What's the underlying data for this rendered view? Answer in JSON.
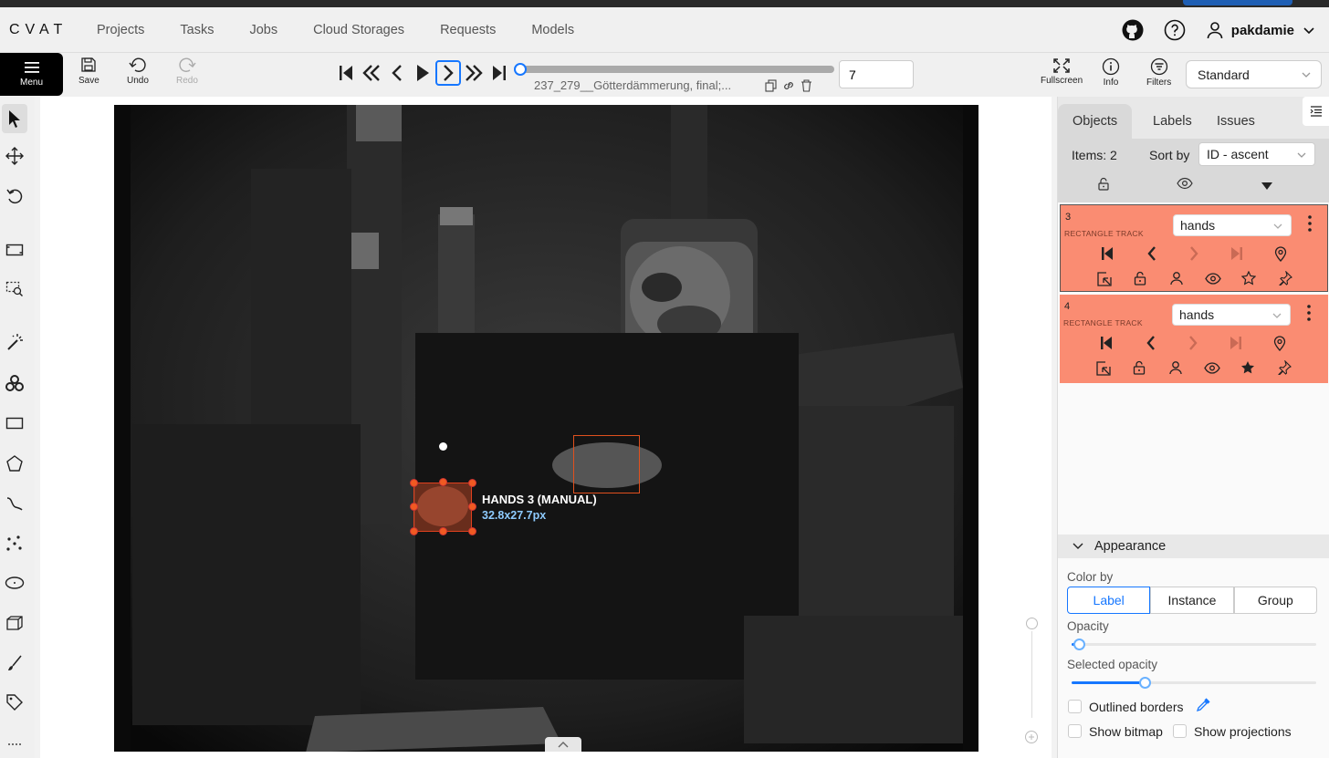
{
  "app": {
    "logo": "CVAT"
  },
  "nav": [
    "Projects",
    "Tasks",
    "Jobs",
    "Cloud Storages",
    "Requests",
    "Models"
  ],
  "user": {
    "name": "pakdamie"
  },
  "toolbar": {
    "menu_label": "Menu",
    "save_label": "Save",
    "undo_label": "Undo",
    "redo_label": "Redo",
    "filename": "237_279__Götterdämmerung, final;...",
    "frame_value": "7",
    "fullscreen_label": "Fullscreen",
    "info_label": "Info",
    "filters_label": "Filters",
    "workspace": "Standard"
  },
  "canvas": {
    "label_text": "HANDS 3 (MANUAL)",
    "size_text": "32.8x27.7px"
  },
  "sidebar": {
    "tabs": [
      "Objects",
      "Labels",
      "Issues"
    ],
    "items_count": "Items: 2",
    "sort_label": "Sort by",
    "sort_value": "ID - ascent",
    "objects": [
      {
        "id": "3",
        "type": "RECTANGLE TRACK",
        "label": "hands",
        "color": "#fa8c72",
        "starred": false
      },
      {
        "id": "4",
        "type": "RECTANGLE TRACK",
        "label": "hands",
        "color": "#fa8c72",
        "starred": true
      }
    ]
  },
  "appearance": {
    "title": "Appearance",
    "color_by_label": "Color by",
    "color_by_options": [
      "Label",
      "Instance",
      "Group"
    ],
    "color_by_selected": "Label",
    "opacity_label": "Opacity",
    "opacity_value": 0.03,
    "selected_opacity_label": "Selected opacity",
    "selected_opacity_value": 0.3,
    "outlined_borders_label": "Outlined borders",
    "show_bitmap_label": "Show bitmap",
    "show_projections_label": "Show projections"
  },
  "colors": {
    "accent": "#1677ff",
    "object": "#fa8c72",
    "box_stroke": "#e0401e"
  }
}
